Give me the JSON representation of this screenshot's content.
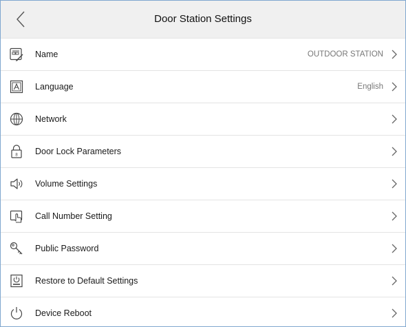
{
  "header": {
    "title": "Door Station Settings",
    "back_icon": "chevron-left-icon"
  },
  "items": [
    {
      "label": "Name",
      "value": "OUTDOOR STATION",
      "icon": "name-card-edit-icon"
    },
    {
      "label": "Language",
      "value": "English",
      "icon": "language-a-icon"
    },
    {
      "label": "Network",
      "value": "",
      "icon": "globe-icon"
    },
    {
      "label": "Door Lock Parameters",
      "value": "",
      "icon": "door-lock-icon"
    },
    {
      "label": "Volume Settings",
      "value": "",
      "icon": "speaker-icon"
    },
    {
      "label": "Call Number Setting",
      "value": "",
      "icon": "call-touch-icon"
    },
    {
      "label": "Public Password",
      "value": "",
      "icon": "key-icon"
    },
    {
      "label": "Restore to Default Settings",
      "value": "",
      "icon": "restore-default-icon"
    },
    {
      "label": "Device Reboot",
      "value": "",
      "icon": "power-icon"
    }
  ],
  "colors": {
    "header_bg": "#f0f0f0",
    "divider": "#e3e3e3",
    "value_text": "#777777",
    "frame_border": "#7fa7cf"
  }
}
